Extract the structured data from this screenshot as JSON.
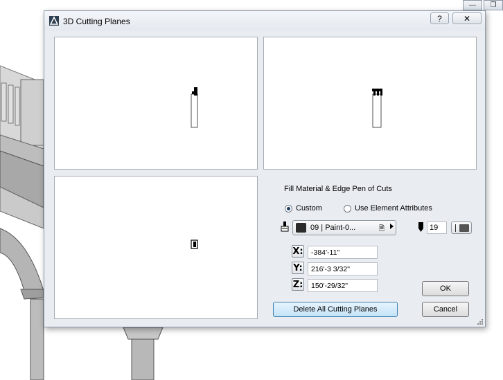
{
  "dialog": {
    "title": "3D Cutting Planes",
    "help_label": "?",
    "close_label": "✕",
    "fill_heading": "Fill Material & Edge Pen of Cuts",
    "radio_custom": "Custom",
    "radio_element_attr": "Use Element Attributes",
    "material_label": "09 | Paint-0...",
    "pen_number": "19",
    "coords": {
      "x_label": "X:",
      "x_value": "-384'-11\"",
      "y_label": "Y:",
      "y_value": "216'-3 3/32\"",
      "z_label": "Z:",
      "z_value": "150'-29/32\""
    },
    "ok_label": "OK",
    "cancel_label": "Cancel",
    "delete_label": "Delete All Cutting Planes"
  },
  "window_controls": {
    "minimize_label": "—",
    "maximize_label": "❐"
  },
  "colors": {
    "dialog_bg": "#e9edf2",
    "delete_button_bg": "#c4e3f8",
    "material_swatch": "#2b2b2b"
  }
}
